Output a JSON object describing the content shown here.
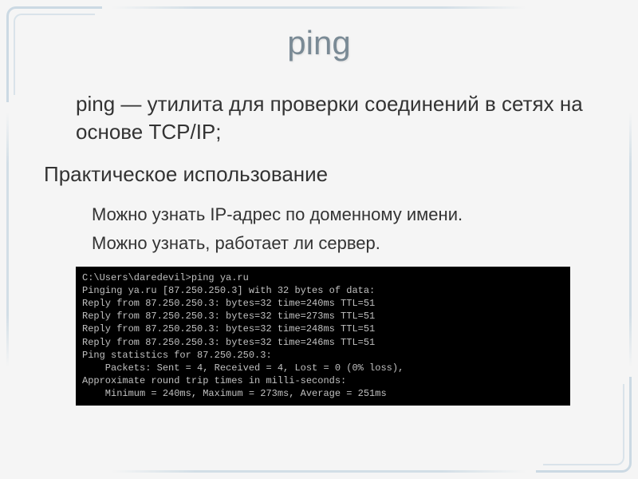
{
  "slide": {
    "title": "ping",
    "paragraph1": "ping — утилита для проверки соединений в сетях на основе TCP/IP;",
    "paragraph2": "Практическое использование",
    "bullet1": "Можно узнать IP-адрес по доменному имени.",
    "bullet2": "Можно узнать, работает ли сервер."
  },
  "terminal": {
    "line1": "C:\\Users\\daredevil>ping ya.ru",
    "line2": "",
    "line3": "Pinging ya.ru [87.250.250.3] with 32 bytes of data:",
    "line4": "Reply from 87.250.250.3: bytes=32 time=240ms TTL=51",
    "line5": "Reply from 87.250.250.3: bytes=32 time=273ms TTL=51",
    "line6": "Reply from 87.250.250.3: bytes=32 time=248ms TTL=51",
    "line7": "Reply from 87.250.250.3: bytes=32 time=246ms TTL=51",
    "line8": "",
    "line9": "Ping statistics for 87.250.250.3:",
    "line10": "    Packets: Sent = 4, Received = 4, Lost = 0 (0% loss),",
    "line11": "Approximate round trip times in milli-seconds:",
    "line12": "    Minimum = 240ms, Maximum = 273ms, Average = 251ms"
  }
}
